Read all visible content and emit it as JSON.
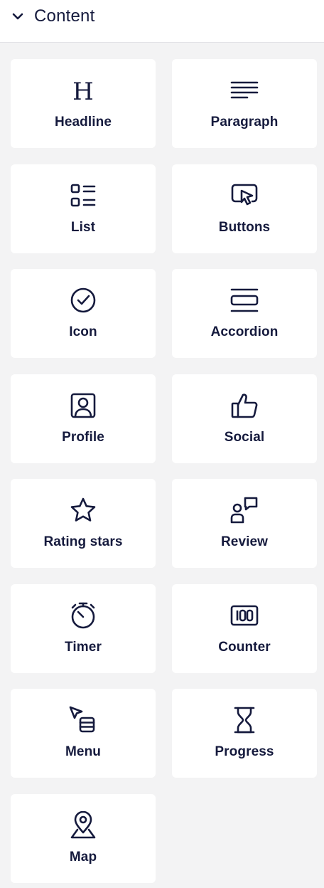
{
  "header": {
    "title": "Content",
    "chevron_icon": "chevron-down-icon"
  },
  "colors": {
    "ink": "#151a3d",
    "tile_bg": "#ffffff",
    "panel_bg": "#f3f3f4"
  },
  "tiles": [
    {
      "label": "Headline",
      "icon": "headline-icon"
    },
    {
      "label": "Paragraph",
      "icon": "paragraph-icon"
    },
    {
      "label": "List",
      "icon": "list-icon"
    },
    {
      "label": "Buttons",
      "icon": "buttons-icon"
    },
    {
      "label": "Icon",
      "icon": "check-circle-icon"
    },
    {
      "label": "Accordion",
      "icon": "accordion-icon"
    },
    {
      "label": "Profile",
      "icon": "profile-icon"
    },
    {
      "label": "Social",
      "icon": "thumbs-up-icon"
    },
    {
      "label": "Rating stars",
      "icon": "star-icon"
    },
    {
      "label": "Review",
      "icon": "review-icon"
    },
    {
      "label": "Timer",
      "icon": "stopwatch-icon"
    },
    {
      "label": "Counter",
      "icon": "counter-icon"
    },
    {
      "label": "Menu",
      "icon": "menu-icon"
    },
    {
      "label": "Progress",
      "icon": "hourglass-icon"
    },
    {
      "label": "Map",
      "icon": "map-pin-icon"
    }
  ]
}
